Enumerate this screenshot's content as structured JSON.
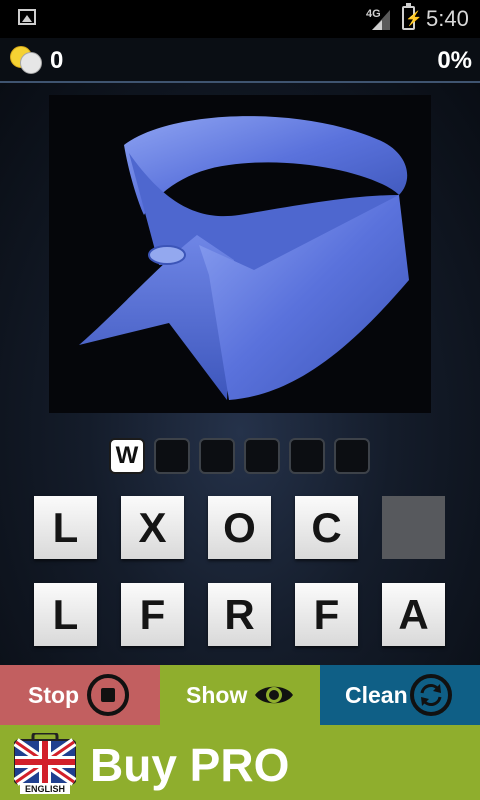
{
  "status_bar": {
    "network": "4G",
    "time": "5:40"
  },
  "header": {
    "coins": "0",
    "progress": "0%"
  },
  "answer": {
    "letters": [
      "W",
      "",
      "",
      "",
      "",
      ""
    ]
  },
  "tiles": {
    "row1": [
      "L",
      "X",
      "O",
      "C",
      ""
    ],
    "row2": [
      "L",
      "F",
      "R",
      "F",
      "A"
    ]
  },
  "actions": {
    "stop": {
      "label": "Stop",
      "color": "#c25f60",
      "icon": "stop-circle-icon"
    },
    "show": {
      "label": "Show",
      "color": "#8fae2d",
      "icon": "eye-icon"
    },
    "clean": {
      "label": "Clean",
      "color": "#0f5f86",
      "icon": "refresh-icon"
    }
  },
  "promo": {
    "title": "Buy PRO",
    "language": "ENGLISH",
    "color": "#8fae2d"
  }
}
